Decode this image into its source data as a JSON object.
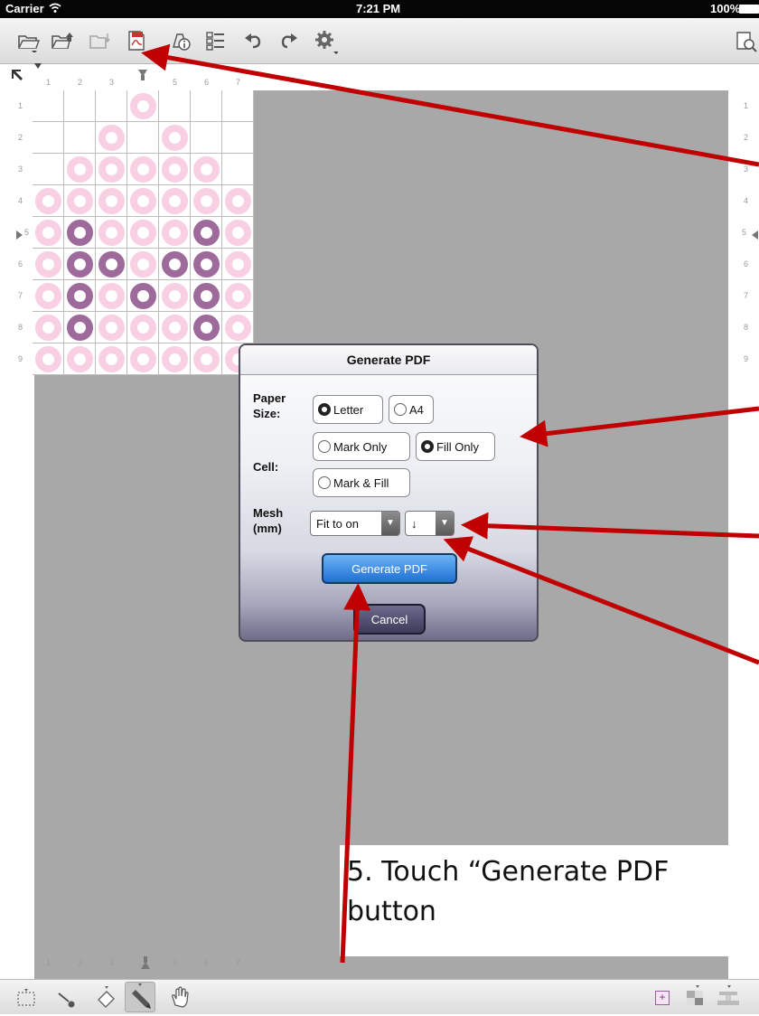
{
  "status_bar": {
    "carrier": "Carrier",
    "time": "7:21 PM",
    "battery": "100%"
  },
  "toolbar": {
    "icons": [
      "folder-open-icon",
      "save-export-icon",
      "folder-import-icon",
      "pdf-icon",
      "info-icon",
      "list-icon",
      "undo-icon",
      "redo-icon",
      "gear-icon",
      "preview-icon"
    ]
  },
  "ruler": {
    "top": [
      "1",
      "2",
      "3",
      "4",
      "5",
      "6",
      "7"
    ],
    "left": [
      "1",
      "2",
      "3",
      "4",
      "5",
      "6",
      "7",
      "8",
      "9"
    ],
    "right": [
      "1",
      "2",
      "3",
      "4",
      "5",
      "6",
      "7",
      "8",
      "9"
    ]
  },
  "grid": {
    "rows": [
      [
        "",
        "",
        "",
        "pink",
        "",
        "",
        ""
      ],
      [
        "",
        "",
        "pink",
        "",
        "pink",
        "",
        ""
      ],
      [
        "",
        "pink",
        "pink",
        "pink",
        "pink",
        "pink",
        ""
      ],
      [
        "pink",
        "pink",
        "pink",
        "pink",
        "pink",
        "pink",
        "pink"
      ],
      [
        "pink",
        "purple",
        "pink",
        "pink",
        "pink",
        "purple",
        "pink"
      ],
      [
        "pink",
        "purple",
        "purple",
        "pink",
        "purple",
        "purple",
        "pink"
      ],
      [
        "pink",
        "purple",
        "pink",
        "purple",
        "pink",
        "purple",
        "pink"
      ],
      [
        "pink",
        "purple",
        "pink",
        "pink",
        "pink",
        "purple",
        "pink"
      ],
      [
        "pink",
        "pink",
        "pink",
        "pink",
        "pink",
        "pink",
        "pink"
      ]
    ],
    "colors": {
      "pink": "#f8cfe3",
      "purple": "#9d6a9b"
    }
  },
  "dialog": {
    "title": "Generate PDF",
    "paper_size_label": "Paper\nSize:",
    "paper_options": [
      {
        "label": "Letter",
        "selected": true
      },
      {
        "label": "A4",
        "selected": false
      }
    ],
    "cell_label": "Cell:",
    "cell_options": [
      {
        "label": "Mark Only",
        "selected": false
      },
      {
        "label": "Fill Only",
        "selected": true
      },
      {
        "label": "Mark & Fill",
        "selected": false
      }
    ],
    "mesh_label": "Mesh\n(mm)",
    "mesh_select_1": "Fit to on",
    "mesh_select_2": "↓",
    "generate_button": "Generate PDF",
    "cancel_button": "Cancel"
  },
  "callout": {
    "text": "5. Touch “Generate PDF\nbutton"
  },
  "bottom_toolbar": {
    "icons": [
      "select-rect-icon",
      "brush-icon",
      "eraser-icon",
      "pencil-icon",
      "hand-icon",
      "zoom-plus-icon",
      "layers-icon",
      "stamp-icon"
    ]
  },
  "arrow_color": "#c00000"
}
